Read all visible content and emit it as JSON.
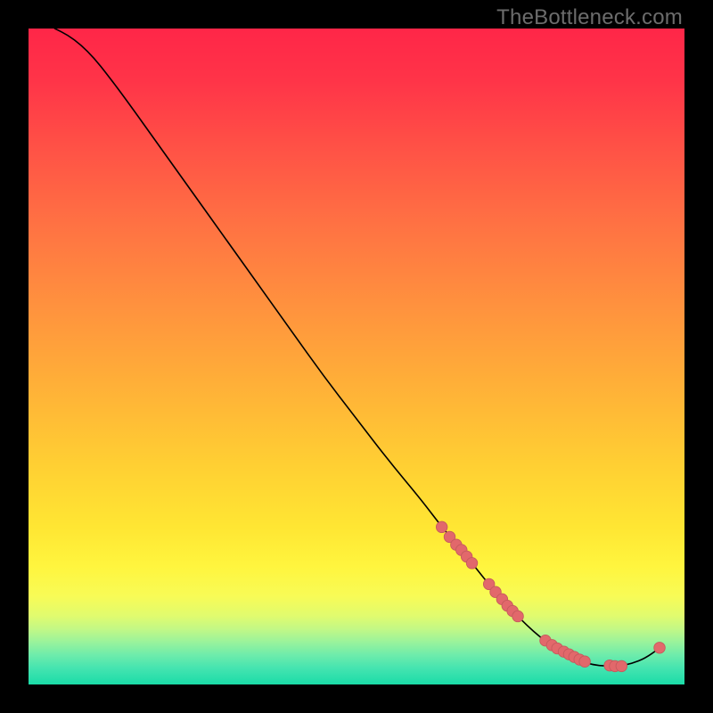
{
  "watermark": "TheBottleneck.com",
  "colors": {
    "black": "#000000",
    "curve": "#000000",
    "dot_fill": "#e2686b",
    "dot_stroke": "#c55a5d",
    "watermark": "#6c6c6c"
  },
  "gradient_stops": [
    {
      "offset": 0.0,
      "color": "#ff2648"
    },
    {
      "offset": 0.08,
      "color": "#ff3448"
    },
    {
      "offset": 0.18,
      "color": "#ff5146"
    },
    {
      "offset": 0.3,
      "color": "#ff7243"
    },
    {
      "offset": 0.42,
      "color": "#ff913e"
    },
    {
      "offset": 0.54,
      "color": "#ffaf38"
    },
    {
      "offset": 0.66,
      "color": "#ffce33"
    },
    {
      "offset": 0.76,
      "color": "#ffe633"
    },
    {
      "offset": 0.82,
      "color": "#fff53e"
    },
    {
      "offset": 0.865,
      "color": "#f8fb56"
    },
    {
      "offset": 0.895,
      "color": "#e1fb6e"
    },
    {
      "offset": 0.915,
      "color": "#c3f885"
    },
    {
      "offset": 0.935,
      "color": "#9af39b"
    },
    {
      "offset": 0.955,
      "color": "#6eecab"
    },
    {
      "offset": 0.975,
      "color": "#45e4b0"
    },
    {
      "offset": 1.0,
      "color": "#1adca8"
    }
  ],
  "chart_data": {
    "type": "line",
    "title": "",
    "xlabel": "",
    "ylabel": "",
    "xlim": [
      0,
      100
    ],
    "ylim": [
      0,
      100
    ],
    "grid": false,
    "series": [
      {
        "name": "bottleneck-curve",
        "x": [
          4,
          6,
          8,
          10,
          12,
          15,
          20,
          25,
          30,
          35,
          40,
          45,
          50,
          55,
          60,
          63,
          66,
          68,
          70,
          72,
          74,
          76,
          78,
          80,
          82,
          84,
          86,
          88,
          90,
          92,
          94,
          96
        ],
        "y": [
          100,
          99,
          97.5,
          95.5,
          93,
          89,
          82,
          75,
          68,
          61,
          54,
          47,
          40.5,
          34,
          28,
          24,
          20.5,
          18,
          15.5,
          13,
          11,
          9,
          7.2,
          5.8,
          4.6,
          3.6,
          3.0,
          2.8,
          2.8,
          3.2,
          4.0,
          5.4
        ]
      }
    ],
    "markers": {
      "name": "highlight-dots",
      "color": "#e2686b",
      "x": [
        63.0,
        64.2,
        65.2,
        66.0,
        66.8,
        67.6,
        70.2,
        71.2,
        72.2,
        73.0,
        73.8,
        74.6,
        78.8,
        79.8,
        80.6,
        81.6,
        82.4,
        83.2,
        84.0,
        84.8,
        88.6,
        89.4,
        90.4,
        96.2
      ],
      "y": [
        24.0,
        22.5,
        21.3,
        20.5,
        19.5,
        18.5,
        15.3,
        14.1,
        13.0,
        12.0,
        11.2,
        10.4,
        6.7,
        6.0,
        5.5,
        5.0,
        4.6,
        4.2,
        3.8,
        3.5,
        2.9,
        2.8,
        2.8,
        5.6
      ]
    }
  }
}
